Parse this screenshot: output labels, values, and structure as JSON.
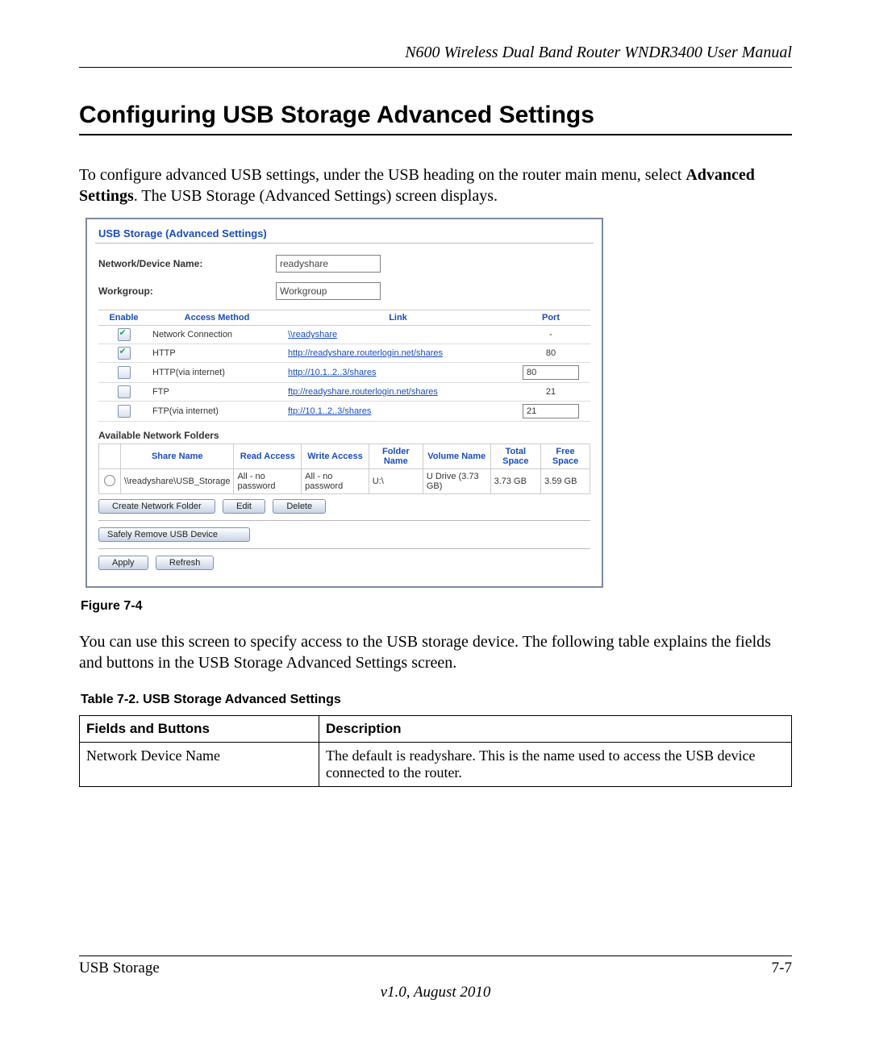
{
  "runningHead": "N600 Wireless Dual Band Router WNDR3400 User Manual",
  "sectionTitle": "Configuring USB Storage Advanced Settings",
  "intro_pre": "To configure advanced USB settings, under the USB heading on the router main menu, select ",
  "intro_bold": "Advanced Settings",
  "intro_post": ". The USB Storage (Advanced Settings) screen displays.",
  "shot": {
    "panelTitle": "USB Storage (Advanced Settings)",
    "networkLabel": "Network/Device Name:",
    "networkValue": "readyshare",
    "workgroupLabel": "Workgroup:",
    "workgroupValue": "Workgroup",
    "cols": {
      "enable": "Enable",
      "method": "Access Method",
      "link": "Link",
      "port": "Port"
    },
    "rows": [
      {
        "checked": true,
        "method": "Network Connection",
        "link": "\\\\readyshare",
        "port": "-",
        "portInput": false
      },
      {
        "checked": true,
        "method": "HTTP",
        "link": "http://readyshare.routerlogin.net/shares",
        "port": "80",
        "portInput": false
      },
      {
        "checked": false,
        "method": "HTTP(via internet)",
        "link": "http://10.1..2..3/shares",
        "port": "80",
        "portInput": true
      },
      {
        "checked": false,
        "method": "FTP",
        "link": "ftp://readyshare.routerlogin.net/shares",
        "port": "21",
        "portInput": false
      },
      {
        "checked": false,
        "method": "FTP(via internet)",
        "link": "ftp://10.1..2..3/shares",
        "port": "21",
        "portInput": true
      }
    ],
    "foldersLabel": "Available Network Folders",
    "fcols": {
      "share": "Share Name",
      "read": "Read Access",
      "write": "Write Access",
      "folder": "Folder Name",
      "volume": "Volume Name",
      "total": "Total Space",
      "free": "Free Space"
    },
    "frow": {
      "share": "\\\\readyshare\\USB_Storage",
      "read": "All - no password",
      "write": "All - no password",
      "folder": "U:\\",
      "volume": "U Drive (3.73 GB)",
      "total": "3.73 GB",
      "free": "3.59 GB"
    },
    "btnCreate": "Create Network Folder",
    "btnEdit": "Edit",
    "btnDelete": "Delete",
    "btnSafe": "Safely Remove USB Device",
    "btnApply": "Apply",
    "btnRefresh": "Refresh"
  },
  "figcap": "Figure 7-4",
  "afterFig": "You can use this screen to specify access to the USB storage device. The following table explains the fields and buttons in the USB Storage Advanced Settings screen.",
  "tablecap": "Table 7-2.  USB Storage Advanced Settings",
  "spec": {
    "h1": "Fields and Buttons",
    "h2": "Description",
    "r1c1": "Network Device Name",
    "r1c2": "The default is readyshare. This is the name used to access the USB device connected to the router."
  },
  "footer": {
    "left": "USB Storage",
    "right": "7-7",
    "version": "v1.0, August 2010"
  }
}
